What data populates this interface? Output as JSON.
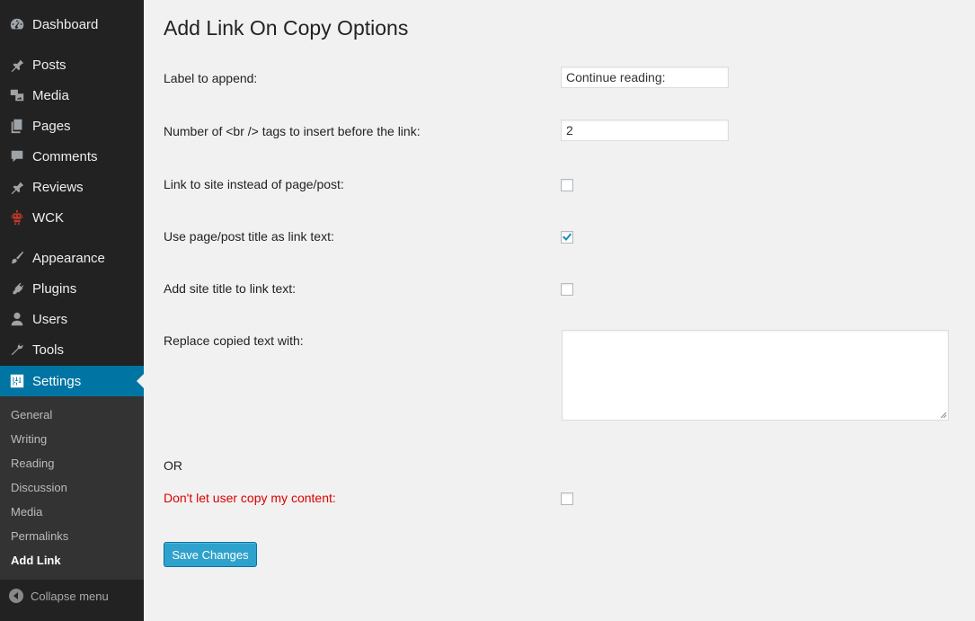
{
  "sidebar": {
    "items": [
      {
        "label": "Dashboard",
        "icon": "dashboard-icon"
      },
      {
        "label": "Posts",
        "icon": "pin-icon"
      },
      {
        "label": "Media",
        "icon": "media-icon"
      },
      {
        "label": "Pages",
        "icon": "pages-icon"
      },
      {
        "label": "Comments",
        "icon": "comment-icon"
      },
      {
        "label": "Reviews",
        "icon": "pin-icon"
      },
      {
        "label": "WCK",
        "icon": "robot-icon"
      },
      {
        "label": "Appearance",
        "icon": "brush-icon"
      },
      {
        "label": "Plugins",
        "icon": "plug-icon"
      },
      {
        "label": "Users",
        "icon": "user-icon"
      },
      {
        "label": "Tools",
        "icon": "wrench-icon"
      },
      {
        "label": "Settings",
        "icon": "settings-icon"
      }
    ],
    "submenu": [
      "General",
      "Writing",
      "Reading",
      "Discussion",
      "Media",
      "Permalinks",
      "Add Link"
    ],
    "collapse_label": "Collapse menu"
  },
  "main": {
    "title": "Add Link On Copy Options",
    "label_append": "Label to append:",
    "label_append_value": "Continue reading:",
    "br_tags": "Number of <br /> tags to insert before the link:",
    "br_tags_value": "2",
    "link_site": "Link to site instead of page/post:",
    "use_title": "Use page/post title as link text:",
    "add_site_title": "Add site title to link text:",
    "replace_text": "Replace copied text with:",
    "or": "OR",
    "no_copy": "Don't let user copy my content:",
    "save": "Save Changes"
  },
  "checkboxes": {
    "link_site": false,
    "use_title": true,
    "add_site_title": false,
    "no_copy": false
  },
  "colors": {
    "sidebar_bg": "#222222",
    "active_bg": "#0074a2",
    "button_bg": "#2ea2cc",
    "warning_text": "#dd0000"
  }
}
